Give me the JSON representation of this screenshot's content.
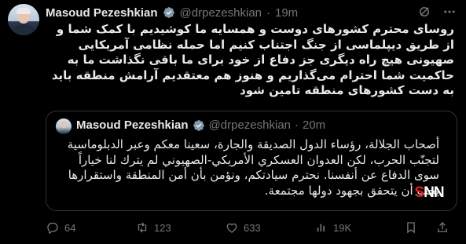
{
  "author": {
    "name": "Masoud Pezeshkian",
    "handle": "@drpezeshkian",
    "separator": "·",
    "time": "19m"
  },
  "tweet_text": "روسای محترم کشورهای دوست و همسایه ما کوشیدیم با کمک شما و از طریق دیپلماسی از جنگ اجتناب کنیم اما حمله نظامی آمریکایی صهیونی هیچ راه دیگری جز دفاع از خود برای ما باقی نگذاشت ما به حاکمیت شما احترام می‌گذاریم و هنوز هم معتقدیم آرامش منطقه باید به دست کشورهای منطقه تامین شود",
  "quoted": {
    "name": "Masoud Pezeshkian",
    "handle": "@drpezeshkian",
    "separator": "·",
    "time": "20m",
    "text": "أصحاب الجلالة، رؤساء الدول الصديقة والجارة، سعينا معكم وعبر الدبلوماسية لتجنّب الحرب، لكن العدوان العسكري الأمريكي-الصهيوني لم يترك لنا خياراً سوى الدفاع عن أنفسنا. نحترم سيادتكم، ونؤمن بأن أمن المنطقة واستقرارها يجب أن يتحقق بجهود دولها مجتمعة."
  },
  "watermark": {
    "s": "S",
    "rest": "NN",
    "tv": "TV"
  },
  "actions": {
    "replies": "64",
    "reposts": "123",
    "likes": "633",
    "views": "19K"
  },
  "icons": [
    "verified-badge-icon",
    "grok-icon",
    "more-icon",
    "reply-icon",
    "repost-icon",
    "like-icon",
    "views-icon",
    "bookmark-icon",
    "share-icon"
  ],
  "colors": {
    "background": "#000000",
    "text": "#e7e9ea",
    "muted": "#71767b",
    "verified": "#829aab",
    "border": "#2f3336",
    "watermark_red": "#e01e26"
  }
}
